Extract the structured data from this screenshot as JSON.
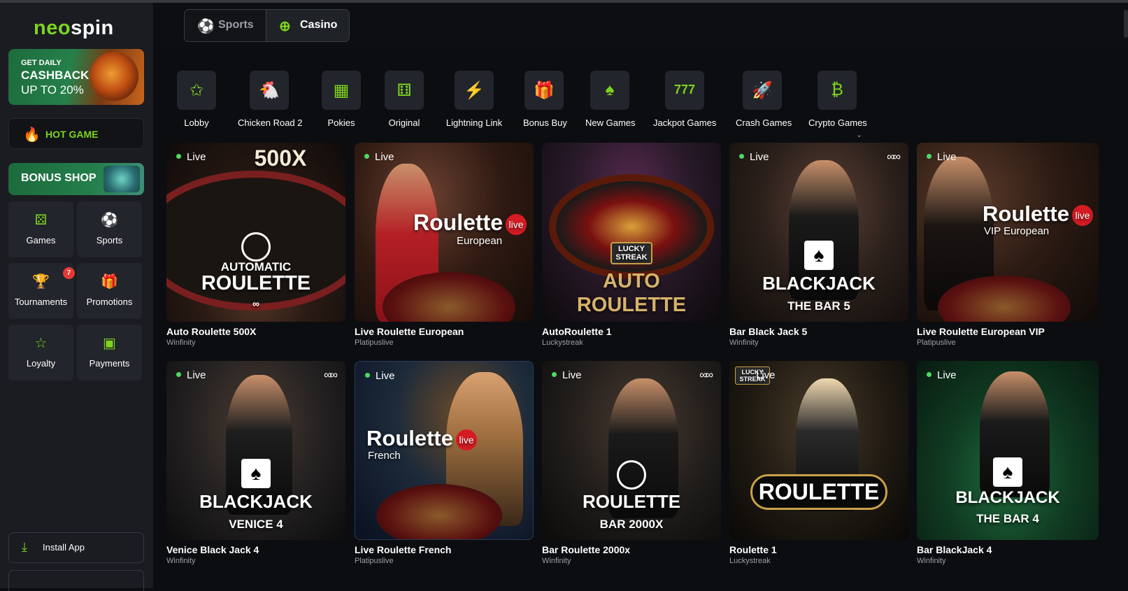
{
  "brand": {
    "logo_neo": "neo",
    "logo_spin": "spin",
    "accent": "#7ed321"
  },
  "sidebar": {
    "cashback": {
      "line1": "GET DAILY",
      "line2": "CASHBACK",
      "line3": "UP TO 20%"
    },
    "hot_game": "HOT GAME",
    "bonus_shop": "BONUS SHOP",
    "tiles": [
      {
        "label": "Games",
        "icon": "dice-icon"
      },
      {
        "label": "Sports",
        "icon": "soccer-ball-icon"
      },
      {
        "label": "Tournaments",
        "icon": "trophy-icon",
        "badge": "7"
      },
      {
        "label": "Promotions",
        "icon": "gift-icon"
      },
      {
        "label": "Loyalty",
        "icon": "star-icon"
      },
      {
        "label": "Payments",
        "icon": "wallet-icon"
      }
    ],
    "install": "Install App"
  },
  "header": {
    "tabs": [
      {
        "label": "Sports",
        "icon": "soccer-ball-icon",
        "active": false
      },
      {
        "label": "Casino",
        "icon": "casino-chip-icon",
        "active": true
      }
    ]
  },
  "categories": [
    {
      "label": "Lobby",
      "icon": "stars-icon"
    },
    {
      "label": "Chicken Road 2",
      "icon": "chicken-icon"
    },
    {
      "label": "Pokies",
      "icon": "slot-machine-icon"
    },
    {
      "label": "Original",
      "icon": "dice-icon"
    },
    {
      "label": "Lightning Link",
      "icon": "lightning-icon"
    },
    {
      "label": "Bonus Buy",
      "icon": "gift-icon"
    },
    {
      "label": "New Games",
      "icon": "cards-icon"
    },
    {
      "label": "Jackpot Games",
      "icon": "777-icon"
    },
    {
      "label": "Crash Games",
      "icon": "rocket-icon"
    },
    {
      "label": "Crypto Games",
      "icon": "bitcoin-icon"
    }
  ],
  "games": [
    {
      "title": "Auto Roulette 500X",
      "provider": "Winfinity",
      "live": "Live",
      "art_top": "500X",
      "art_line1": "AUTOMATIC",
      "art_line2": "ROULETTE"
    },
    {
      "title": "Live Roulette European",
      "provider": "Platipuslive",
      "live": "Live",
      "art_line1": "Roulette",
      "art_line2": "European",
      "live_tag": "live"
    },
    {
      "title": "AutoRoulette 1",
      "provider": "Luckystreak",
      "live": "",
      "art_top": "LUCKY STREAK",
      "art_line1": "AUTO",
      "art_line2": "ROULETTE"
    },
    {
      "title": "Bar Black Jack 5",
      "provider": "Winfinity",
      "live": "Live",
      "art_line1": "BLACKJACK",
      "art_line2": "THE BAR 5"
    },
    {
      "title": "Live Roulette European VIP",
      "provider": "Platipuslive",
      "live": "Live",
      "art_line1": "Roulette",
      "art_line2": "VIP European",
      "live_tag": "live"
    },
    {
      "title": "Venice Black Jack 4",
      "provider": "Winfinity",
      "live": "Live",
      "art_line1": "BLACKJACK",
      "art_line2": "VENICE 4"
    },
    {
      "title": "Live Roulette French",
      "provider": "Platipuslive",
      "live": "Live",
      "art_line1": "Roulette",
      "art_line2": "French",
      "live_tag": "live"
    },
    {
      "title": "Bar Roulette 2000x",
      "provider": "Winfinity",
      "live": "Live",
      "art_line1": "ROULETTE",
      "art_line2": "BAR 2000X"
    },
    {
      "title": "Roulette 1",
      "provider": "Luckystreak",
      "live": "Live",
      "art_top": "LUCKY STREAK",
      "art_line1": "ROULETTE"
    },
    {
      "title": "Bar BlackJack 4",
      "provider": "Winfinity",
      "live": "Live",
      "art_line1": "BLACKJACK",
      "art_line2": "THE BAR 4"
    }
  ]
}
